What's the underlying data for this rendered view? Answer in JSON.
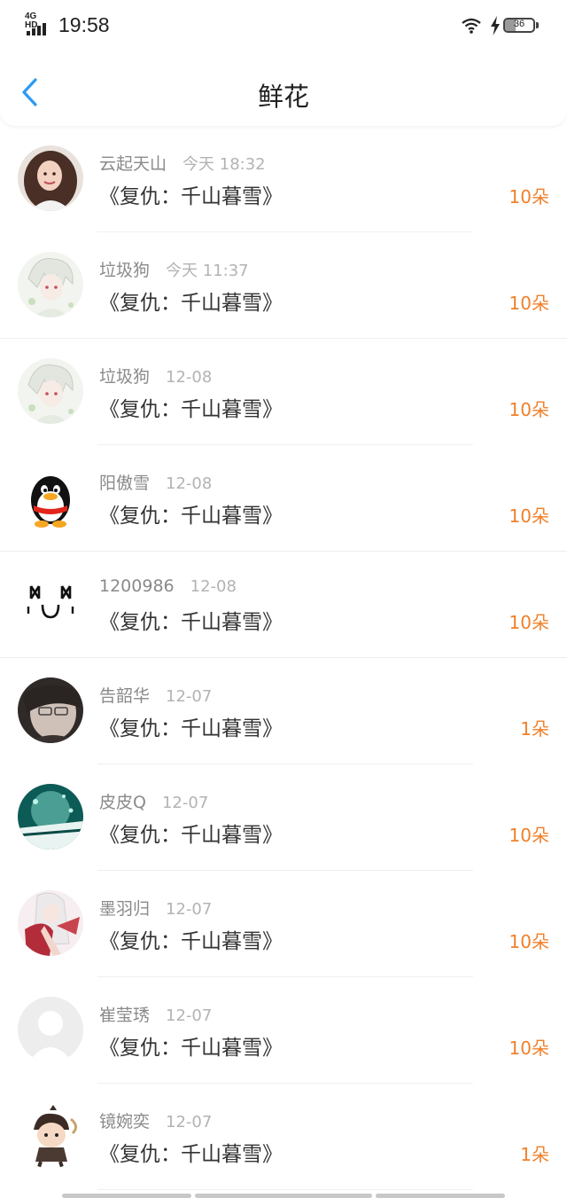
{
  "status_bar": {
    "network": "4G HD",
    "time": "19:58",
    "battery_level": "36",
    "battery_fraction": 0.36,
    "icons": [
      "signal-icon",
      "wifi-icon",
      "charging-icon",
      "battery-icon"
    ]
  },
  "nav": {
    "title": "鲜花",
    "back_icon": "chevron-left-icon",
    "accent_color": "#2b9af3"
  },
  "colors": {
    "quantity": "#f0802a",
    "username": "#8a8a8a",
    "timestamp": "#b3b3b3",
    "book_title": "#333333"
  },
  "gifts": [
    {
      "user": "云起天山",
      "time": "今天 18:32",
      "book": "《复仇：千山暮雪》",
      "quantity": "10朵",
      "avatar": "photo-avatar-girl"
    },
    {
      "user": "垃圾狗",
      "time": "今天 11:37",
      "book": "《复仇：千山暮雪》",
      "quantity": "10朵",
      "avatar": "anime-avatar-white-hair"
    },
    {
      "user": "垃圾狗",
      "time": "12-08",
      "book": "《复仇：千山暮雪》",
      "quantity": "10朵",
      "avatar": "anime-avatar-white-hair"
    },
    {
      "user": "阳傲雪",
      "time": "12-08",
      "book": "《复仇：千山暮雪》",
      "quantity": "10朵",
      "avatar": "penguin-avatar"
    },
    {
      "user": "1200986",
      "time": "12-08",
      "book": "《复仇：千山暮雪》",
      "quantity": "10朵",
      "avatar": "emoticon-avatar"
    },
    {
      "user": "告韶华",
      "time": "12-07",
      "book": "《复仇：千山暮雪》",
      "quantity": "1朵",
      "avatar": "photo-avatar-dark"
    },
    {
      "user": "皮皮Q",
      "time": "12-07",
      "book": "《复仇：千山暮雪》",
      "quantity": "10朵",
      "avatar": "scenery-avatar-teal"
    },
    {
      "user": "墨羽归",
      "time": "12-07",
      "book": "《复仇：千山暮雪》",
      "quantity": "10朵",
      "avatar": "anime-avatar-red"
    },
    {
      "user": "崔莹琇",
      "time": "12-07",
      "book": "《复仇：千山暮雪》",
      "quantity": "10朵",
      "avatar": "default-avatar"
    },
    {
      "user": "镜婉奕",
      "time": "12-07",
      "book": "《复仇：千山暮雪》",
      "quantity": "1朵",
      "avatar": "cartoon-avatar"
    }
  ]
}
